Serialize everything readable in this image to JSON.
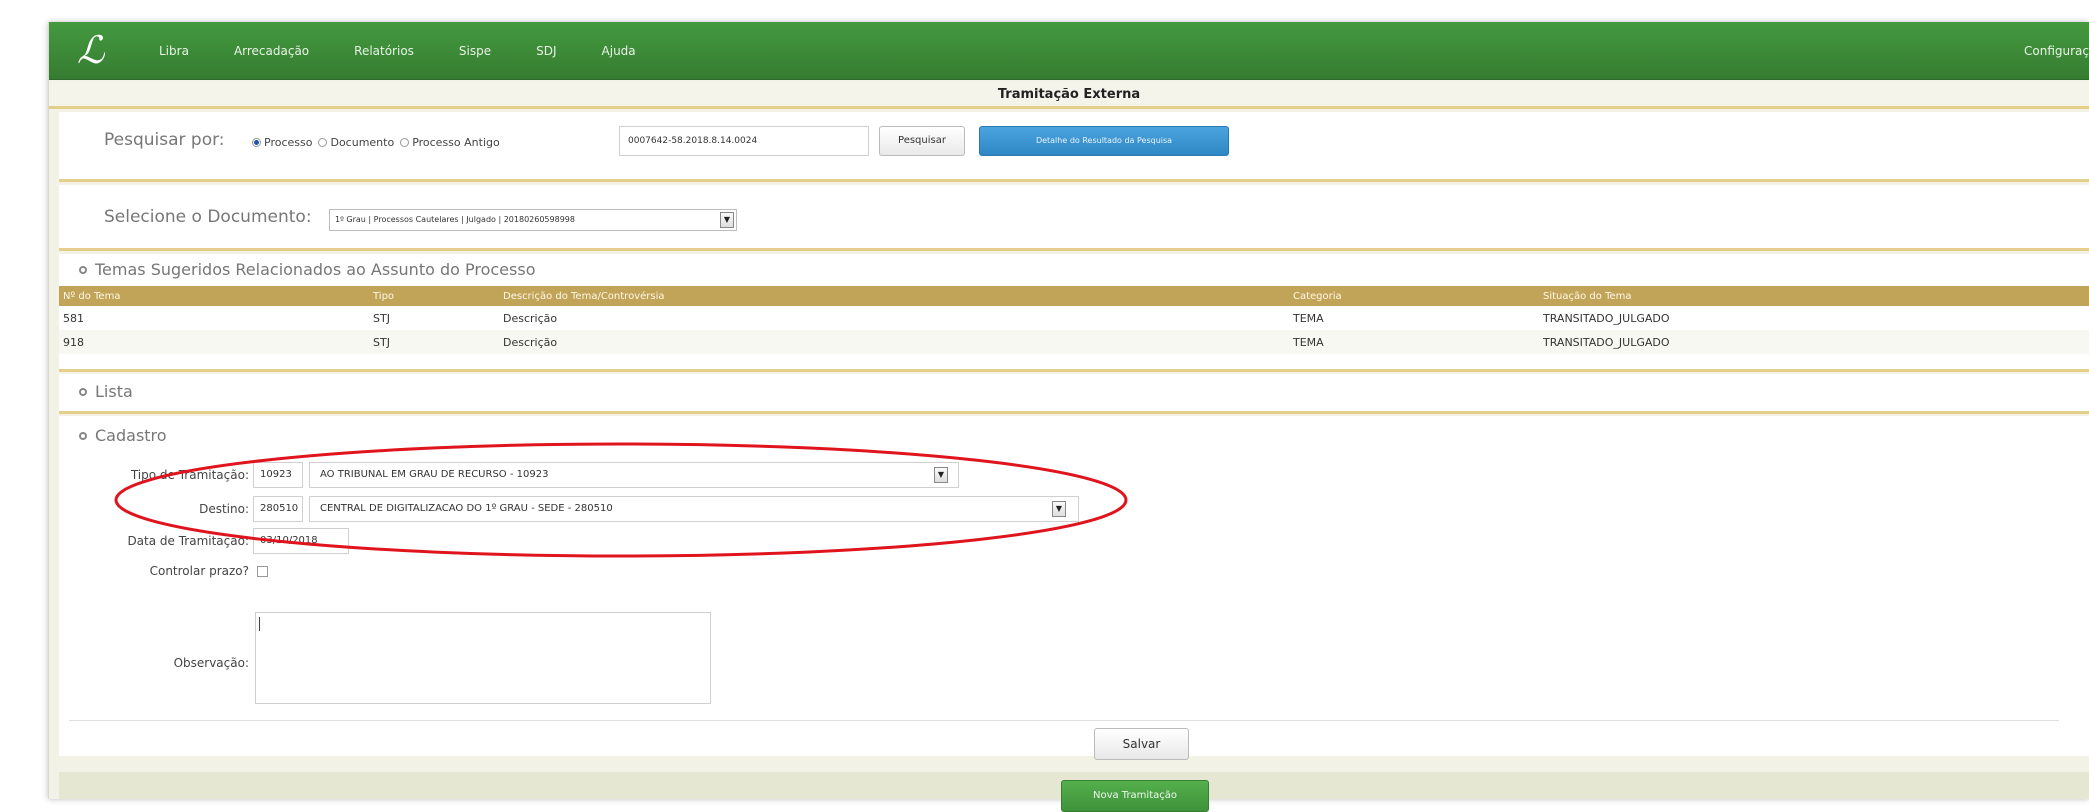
{
  "nav": {
    "logo_glyph": "ℒ",
    "items": [
      "Libra",
      "Arrecadação",
      "Relatórios",
      "Sispe",
      "SDJ",
      "Ajuda"
    ],
    "config_label": "Configuraç"
  },
  "page": {
    "title": "Tramitação Externa"
  },
  "search": {
    "label": "Pesquisar por:",
    "options": [
      {
        "label": "Processo",
        "selected": true
      },
      {
        "label": "Documento",
        "selected": false
      },
      {
        "label": "Processo Antigo",
        "selected": false
      }
    ],
    "value": "0007642-58.2018.8.14.0024",
    "search_button": "Pesquisar",
    "detail_button": "Detalhe do Resultado da Pesquisa"
  },
  "document": {
    "label": "Selecione o Documento:",
    "selected": "1º Grau | Processos Cautelares | Julgado | 20180260598998"
  },
  "temas": {
    "heading": "Temas Sugeridos Relacionados ao Assunto do Processo",
    "columns": [
      "Nº do Tema",
      "Tipo",
      "Descrição do Tema/Controvérsia",
      "Categoria",
      "Situação do Tema"
    ],
    "rows": [
      [
        "581",
        "STJ",
        "Descrição",
        "TEMA",
        "TRANSITADO_JULGADO"
      ],
      [
        "918",
        "STJ",
        "Descrição",
        "TEMA",
        "TRANSITADO_JULGADO"
      ]
    ]
  },
  "lista": {
    "heading": "Lista"
  },
  "cadastro": {
    "heading": "Cadastro",
    "tipo_label": "Tipo de Tramitação:",
    "tipo_code": "10923",
    "tipo_value": "AO TRIBUNAL EM GRAU DE RECURSO - 10923",
    "destino_label": "Destino:",
    "destino_code": "280510",
    "destino_value": "CENTRAL DE DIGITALIZACAO DO 1º GRAU - SEDE - 280510",
    "data_label": "Data de Tramitação:",
    "data_value": "03/10/2018",
    "prazo_label": "Controlar prazo?",
    "obs_label": "Observação:",
    "save_button": "Salvar",
    "new_button": "Nova Tramitação"
  },
  "colors": {
    "nav_green": "#3b8a37",
    "table_header": "#c2a459",
    "section_border": "#e4cf8a",
    "primary_blue": "#2f86c4",
    "annotation_red": "#e0141c"
  }
}
